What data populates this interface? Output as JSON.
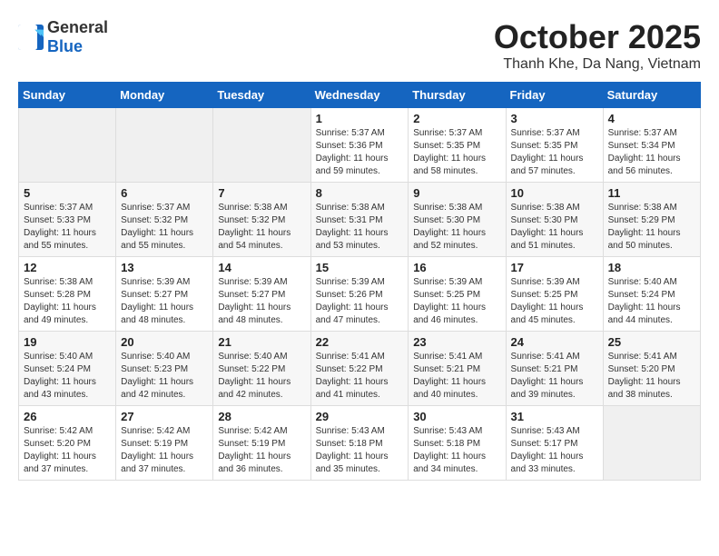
{
  "header": {
    "logo_general": "General",
    "logo_blue": "Blue",
    "month": "October 2025",
    "location": "Thanh Khe, Da Nang, Vietnam"
  },
  "days_of_week": [
    "Sunday",
    "Monday",
    "Tuesday",
    "Wednesday",
    "Thursday",
    "Friday",
    "Saturday"
  ],
  "weeks": [
    [
      {
        "day": "",
        "info": ""
      },
      {
        "day": "",
        "info": ""
      },
      {
        "day": "",
        "info": ""
      },
      {
        "day": "1",
        "info": "Sunrise: 5:37 AM\nSunset: 5:36 PM\nDaylight: 11 hours\nand 59 minutes."
      },
      {
        "day": "2",
        "info": "Sunrise: 5:37 AM\nSunset: 5:35 PM\nDaylight: 11 hours\nand 58 minutes."
      },
      {
        "day": "3",
        "info": "Sunrise: 5:37 AM\nSunset: 5:35 PM\nDaylight: 11 hours\nand 57 minutes."
      },
      {
        "day": "4",
        "info": "Sunrise: 5:37 AM\nSunset: 5:34 PM\nDaylight: 11 hours\nand 56 minutes."
      }
    ],
    [
      {
        "day": "5",
        "info": "Sunrise: 5:37 AM\nSunset: 5:33 PM\nDaylight: 11 hours\nand 55 minutes."
      },
      {
        "day": "6",
        "info": "Sunrise: 5:37 AM\nSunset: 5:32 PM\nDaylight: 11 hours\nand 55 minutes."
      },
      {
        "day": "7",
        "info": "Sunrise: 5:38 AM\nSunset: 5:32 PM\nDaylight: 11 hours\nand 54 minutes."
      },
      {
        "day": "8",
        "info": "Sunrise: 5:38 AM\nSunset: 5:31 PM\nDaylight: 11 hours\nand 53 minutes."
      },
      {
        "day": "9",
        "info": "Sunrise: 5:38 AM\nSunset: 5:30 PM\nDaylight: 11 hours\nand 52 minutes."
      },
      {
        "day": "10",
        "info": "Sunrise: 5:38 AM\nSunset: 5:30 PM\nDaylight: 11 hours\nand 51 minutes."
      },
      {
        "day": "11",
        "info": "Sunrise: 5:38 AM\nSunset: 5:29 PM\nDaylight: 11 hours\nand 50 minutes."
      }
    ],
    [
      {
        "day": "12",
        "info": "Sunrise: 5:38 AM\nSunset: 5:28 PM\nDaylight: 11 hours\nand 49 minutes."
      },
      {
        "day": "13",
        "info": "Sunrise: 5:39 AM\nSunset: 5:27 PM\nDaylight: 11 hours\nand 48 minutes."
      },
      {
        "day": "14",
        "info": "Sunrise: 5:39 AM\nSunset: 5:27 PM\nDaylight: 11 hours\nand 48 minutes."
      },
      {
        "day": "15",
        "info": "Sunrise: 5:39 AM\nSunset: 5:26 PM\nDaylight: 11 hours\nand 47 minutes."
      },
      {
        "day": "16",
        "info": "Sunrise: 5:39 AM\nSunset: 5:25 PM\nDaylight: 11 hours\nand 46 minutes."
      },
      {
        "day": "17",
        "info": "Sunrise: 5:39 AM\nSunset: 5:25 PM\nDaylight: 11 hours\nand 45 minutes."
      },
      {
        "day": "18",
        "info": "Sunrise: 5:40 AM\nSunset: 5:24 PM\nDaylight: 11 hours\nand 44 minutes."
      }
    ],
    [
      {
        "day": "19",
        "info": "Sunrise: 5:40 AM\nSunset: 5:24 PM\nDaylight: 11 hours\nand 43 minutes."
      },
      {
        "day": "20",
        "info": "Sunrise: 5:40 AM\nSunset: 5:23 PM\nDaylight: 11 hours\nand 42 minutes."
      },
      {
        "day": "21",
        "info": "Sunrise: 5:40 AM\nSunset: 5:22 PM\nDaylight: 11 hours\nand 42 minutes."
      },
      {
        "day": "22",
        "info": "Sunrise: 5:41 AM\nSunset: 5:22 PM\nDaylight: 11 hours\nand 41 minutes."
      },
      {
        "day": "23",
        "info": "Sunrise: 5:41 AM\nSunset: 5:21 PM\nDaylight: 11 hours\nand 40 minutes."
      },
      {
        "day": "24",
        "info": "Sunrise: 5:41 AM\nSunset: 5:21 PM\nDaylight: 11 hours\nand 39 minutes."
      },
      {
        "day": "25",
        "info": "Sunrise: 5:41 AM\nSunset: 5:20 PM\nDaylight: 11 hours\nand 38 minutes."
      }
    ],
    [
      {
        "day": "26",
        "info": "Sunrise: 5:42 AM\nSunset: 5:20 PM\nDaylight: 11 hours\nand 37 minutes."
      },
      {
        "day": "27",
        "info": "Sunrise: 5:42 AM\nSunset: 5:19 PM\nDaylight: 11 hours\nand 37 minutes."
      },
      {
        "day": "28",
        "info": "Sunrise: 5:42 AM\nSunset: 5:19 PM\nDaylight: 11 hours\nand 36 minutes."
      },
      {
        "day": "29",
        "info": "Sunrise: 5:43 AM\nSunset: 5:18 PM\nDaylight: 11 hours\nand 35 minutes."
      },
      {
        "day": "30",
        "info": "Sunrise: 5:43 AM\nSunset: 5:18 PM\nDaylight: 11 hours\nand 34 minutes."
      },
      {
        "day": "31",
        "info": "Sunrise: 5:43 AM\nSunset: 5:17 PM\nDaylight: 11 hours\nand 33 minutes."
      },
      {
        "day": "",
        "info": ""
      }
    ]
  ]
}
